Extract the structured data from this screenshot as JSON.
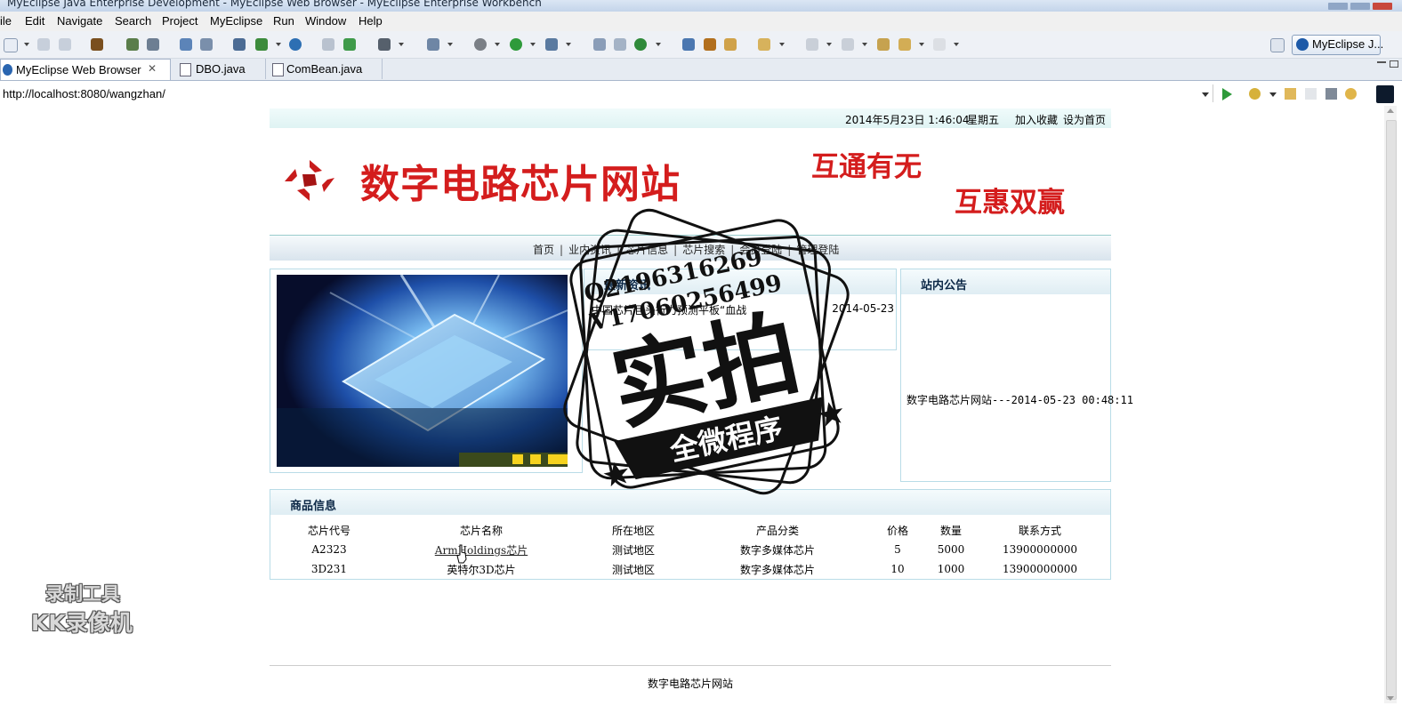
{
  "window": {
    "title": "MyEclipse Java Enterprise Development - MyEclipse Web Browser - MyEclipse Enterprise Workbench"
  },
  "menu": [
    "ile",
    "Edit",
    "Navigate",
    "Search",
    "Project",
    "MyEclipse",
    "Run",
    "Window",
    "Help"
  ],
  "perspective": {
    "label": "MyEclipse J..."
  },
  "tabs": [
    {
      "label": "MyEclipse Web Browser",
      "active": true,
      "close": "✕"
    },
    {
      "label": "DBO.java",
      "active": false
    },
    {
      "label": "ComBean.java",
      "active": false
    }
  ],
  "address": {
    "url": "http://localhost:8080/wangzhan/"
  },
  "site": {
    "topinfo": {
      "datetime": "2014年5月23日 1:46:04",
      "weekday": "星期五",
      "bookmark": "加入收藏",
      "homepage": "设为首页"
    },
    "title": "数字电路芯片网站",
    "slogan1": "互通有无",
    "slogan2": "互惠双赢",
    "nav": [
      "首页",
      "业内资讯",
      "芯片信息",
      "芯片搜索",
      "会员登陆",
      "管理登陆"
    ],
    "news_title": "最新资讯",
    "news": [
      {
        "text": "中国芯片巨头行力预测平板“血战",
        "date": "2014-05-23"
      }
    ],
    "notice_title": "站内公告",
    "notice_text": "数字电路芯片网站---2014-05-23 00:48:11",
    "products_title": "商品信息",
    "products_headers": [
      "芯片代号",
      "芯片名称",
      "所在地区",
      "产品分类",
      "价格",
      "数量",
      "联系方式"
    ],
    "products": [
      [
        "A2323",
        "ArmHoldings芯片",
        "测试地区",
        "数字多媒体芯片",
        "5",
        "5000",
        "13900000000"
      ],
      [
        "3D231",
        "英特尔3D芯片",
        "测试地区",
        "数字多媒体芯片",
        "10",
        "1000",
        "13900000000"
      ]
    ],
    "footer": "数字电路芯片网站"
  },
  "overlay": {
    "stamp_line1": "Q2196316269",
    "stamp_line2": "V17060256499",
    "stamp_big": "实拍",
    "stamp_band": "全微程序",
    "watermark_line1": "录制工具",
    "watermark_line2": "KK录像机"
  },
  "colors": {
    "brand_red": "#d41d1d",
    "nav_bg": "#d9e4ed",
    "box_border": "#b9dce7"
  }
}
